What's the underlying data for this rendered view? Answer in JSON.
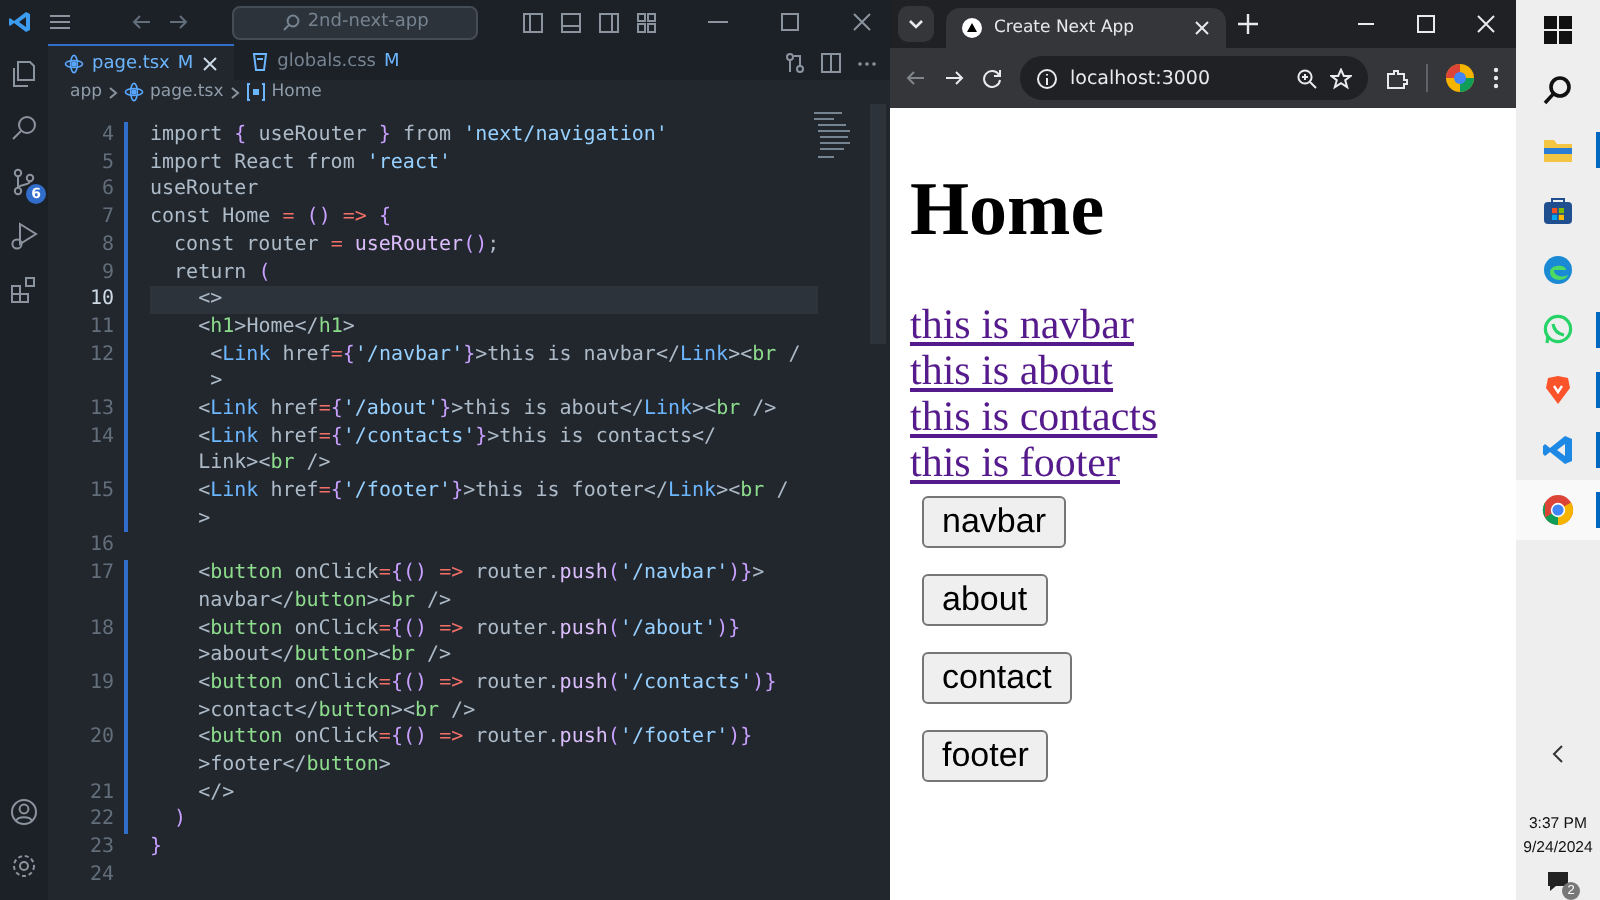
{
  "editor": {
    "search": "2nd-next-app",
    "source_control_badge": "6",
    "tabs": [
      {
        "label": "page.tsx",
        "badge": "M",
        "selected": true,
        "kind": "react"
      },
      {
        "label": "globals.css",
        "badge": "M",
        "selected": false,
        "kind": "css"
      }
    ],
    "breadcrumb": [
      {
        "label": "app",
        "kind": "folder"
      },
      {
        "label": "page.tsx",
        "kind": "react"
      },
      {
        "label": "Home",
        "kind": "symbol"
      }
    ],
    "lines": [
      {
        "number": "4",
        "modified": true,
        "active": false,
        "rows": [
          "import { useRouter } from 'next/navigation'"
        ]
      },
      {
        "number": "5",
        "modified": true,
        "active": false,
        "rows": [
          "import React from 'react'"
        ]
      },
      {
        "number": "6",
        "modified": true,
        "active": false,
        "rows": [
          "useRouter"
        ]
      },
      {
        "number": "7",
        "modified": true,
        "active": false,
        "rows": [
          "const Home = () => {"
        ]
      },
      {
        "number": "8",
        "modified": true,
        "active": false,
        "rows": [
          "  const router = useRouter();"
        ]
      },
      {
        "number": "9",
        "modified": true,
        "active": false,
        "rows": [
          "  return ("
        ]
      },
      {
        "number": "10",
        "modified": true,
        "active": true,
        "rows": [
          "    <>"
        ]
      },
      {
        "number": "11",
        "modified": true,
        "active": false,
        "rows": [
          "    <h1>Home</h1>"
        ]
      },
      {
        "number": "12",
        "modified": true,
        "active": false,
        "rows": [
          "     <Link href={'/navbar'}>this is navbar</Link><br /",
          "     >"
        ]
      },
      {
        "number": "13",
        "modified": true,
        "active": false,
        "rows": [
          "    <Link href={'/about'}>this is about</Link><br />"
        ]
      },
      {
        "number": "14",
        "modified": true,
        "active": false,
        "rows": [
          "    <Link href={'/contacts'}>this is contacts</",
          "    Link><br />"
        ]
      },
      {
        "number": "15",
        "modified": true,
        "active": false,
        "rows": [
          "    <Link href={'/footer'}>this is footer</Link><br /",
          "    >"
        ]
      },
      {
        "number": "16",
        "modified": false,
        "active": false
      },
      {
        "number": "17",
        "modified": true,
        "active": false,
        "rows": [
          "    <button onClick={() => router.push('/navbar')}>",
          "    navbar</button><br />"
        ]
      },
      {
        "number": "18",
        "modified": true,
        "active": false,
        "rows": [
          "    <button onClick={() => router.push('/about')}",
          "    >about</button><br />"
        ]
      },
      {
        "number": "19",
        "modified": true,
        "active": false,
        "rows": [
          "    <button onClick={() => router.push('/contacts')}",
          "    >contact</button><br />"
        ]
      },
      {
        "number": "20",
        "modified": true,
        "active": false,
        "rows": [
          "    <button onClick={() => router.push('/footer')}",
          "    >footer</button>"
        ]
      },
      {
        "number": "21",
        "modified": true,
        "active": false,
        "rows": [
          "    </>"
        ]
      },
      {
        "number": "22",
        "modified": true,
        "active": false,
        "rows": [
          "  )"
        ]
      },
      {
        "number": "23",
        "modified": false,
        "active": false,
        "rows": [
          "}"
        ]
      },
      {
        "number": "24",
        "modified": false,
        "active": false
      }
    ]
  },
  "browser": {
    "tab_title": "Create Next App",
    "address": "localhost:3000",
    "page": {
      "heading": "Home",
      "links": [
        "this is navbar",
        "this is about",
        "this is contacts",
        "this is footer"
      ],
      "buttons": [
        "navbar",
        "about",
        "contact",
        "footer"
      ]
    }
  },
  "taskbar": {
    "apps": [
      {
        "kind": "windows",
        "running": false,
        "selected": false
      },
      {
        "kind": "search",
        "running": false,
        "selected": false
      },
      {
        "kind": "explorer",
        "running": true,
        "selected": false
      },
      {
        "kind": "store",
        "running": false,
        "selected": false
      },
      {
        "kind": "edge",
        "running": false,
        "selected": false
      },
      {
        "kind": "whatsapp",
        "running": true,
        "selected": false
      },
      {
        "kind": "brave",
        "running": true,
        "selected": false
      },
      {
        "kind": "vscode",
        "running": true,
        "selected": false
      },
      {
        "kind": "chrome",
        "running": true,
        "selected": true
      }
    ],
    "time": "3:37 PM",
    "date": "9/24/2024",
    "notifications": "2"
  }
}
